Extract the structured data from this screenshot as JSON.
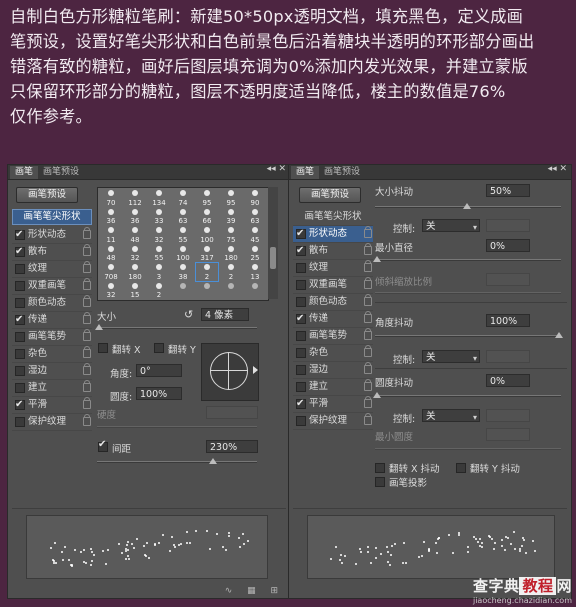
{
  "intro": {
    "lines": [
      "自制白色方形糖粒笔刷：新建50*50px透明文档，填充黑色，定义成画",
      "笔预设，设置好笔尖形状和白色前景色后沿着糖块半透明的环形部分画出",
      "错落有致的糖粒，画好后图层填充调为0%添加内发光效果，并建立蒙版",
      "只保留环形部分的糖粒，图层不透明度适当降低，楼主的数值是76%",
      "仅作参考。"
    ]
  },
  "left_panel": {
    "tabs": [
      "画笔",
      "画笔预设"
    ],
    "preset_button": "画笔预设",
    "options": [
      {
        "label": "画笔笔尖形状",
        "selected": true
      },
      {
        "label": "形状动态",
        "checked": true,
        "lock": true
      },
      {
        "label": "散布",
        "checked": true,
        "lock": true
      },
      {
        "label": "纹理",
        "checked": false,
        "lock": true
      },
      {
        "label": "双重画笔",
        "checked": false,
        "lock": true
      },
      {
        "label": "颜色动态",
        "checked": false,
        "lock": true
      },
      {
        "label": "传递",
        "checked": true,
        "lock": true
      },
      {
        "label": "画笔笔势",
        "checked": false,
        "lock": true
      },
      {
        "label": "杂色",
        "checked": false,
        "lock": true
      },
      {
        "label": "湿边",
        "checked": false,
        "lock": true
      },
      {
        "label": "建立",
        "checked": false,
        "lock": true
      },
      {
        "label": "平滑",
        "checked": true,
        "lock": true
      },
      {
        "label": "保护纹理",
        "checked": false,
        "lock": true
      }
    ],
    "brush_sizes": [
      [
        "70",
        "112",
        "134",
        "74",
        "95",
        "95",
        "90"
      ],
      [
        "36",
        "36",
        "33",
        "63",
        "66",
        "39",
        "63"
      ],
      [
        "11",
        "48",
        "32",
        "55",
        "100",
        "75",
        "45"
      ],
      [
        "48",
        "32",
        "55",
        "100",
        "317",
        "180",
        "25"
      ],
      [
        "708",
        "180",
        "3",
        "38",
        "2",
        "2",
        "13"
      ],
      [
        "32",
        "15",
        "2",
        "",
        "",
        "",
        ""
      ]
    ],
    "selected_brush": "2",
    "size_label": "大小",
    "size_value": "4 像素",
    "flip_x": "翻转 X",
    "flip_y": "翻转 Y",
    "angle_label": "角度:",
    "angle_value": "0°",
    "roundness_label": "圆度:",
    "roundness_value": "100%",
    "hardness_label": "硬度",
    "spacing_label": "间距",
    "spacing_value": "230%",
    "spacing_checked": true
  },
  "right_panel": {
    "tabs": [
      "画笔",
      "画笔预设"
    ],
    "preset_button": "画笔预设",
    "options": [
      {
        "label": "画笔笔尖形状",
        "selected": false
      },
      {
        "label": "形状动态",
        "checked": true,
        "lock": true,
        "active": true
      },
      {
        "label": "散布",
        "checked": true,
        "lock": true
      },
      {
        "label": "纹理",
        "checked": false,
        "lock": true
      },
      {
        "label": "双重画笔",
        "checked": false,
        "lock": true
      },
      {
        "label": "颜色动态",
        "checked": false,
        "lock": true
      },
      {
        "label": "传递",
        "checked": true,
        "lock": true
      },
      {
        "label": "画笔笔势",
        "checked": false,
        "lock": true
      },
      {
        "label": "杂色",
        "checked": false,
        "lock": true
      },
      {
        "label": "湿边",
        "checked": false,
        "lock": true
      },
      {
        "label": "建立",
        "checked": false,
        "lock": true
      },
      {
        "label": "平滑",
        "checked": true,
        "lock": true
      },
      {
        "label": "保护纹理",
        "checked": false,
        "lock": true
      }
    ],
    "size_jitter_label": "大小抖动",
    "size_jitter_value": "50%",
    "control_label": "控制:",
    "control_value": "关",
    "min_diameter_label": "最小直径",
    "min_diameter_value": "0%",
    "tilt_scale_label": "倾斜缩放比例",
    "angle_jitter_label": "角度抖动",
    "angle_jitter_value": "100%",
    "roundness_jitter_label": "圆度抖动",
    "roundness_jitter_value": "0%",
    "min_roundness_label": "最小圆度",
    "flip_x_jitter": "翻转 X 抖动",
    "flip_y_jitter": "翻转 Y 抖动",
    "brush_projection": "画笔投影"
  },
  "watermark": {
    "line1_a": "查字典",
    "line1_b": "教程",
    "line1_c": "网",
    "line2": "jiaocheng.chazidian.com"
  }
}
